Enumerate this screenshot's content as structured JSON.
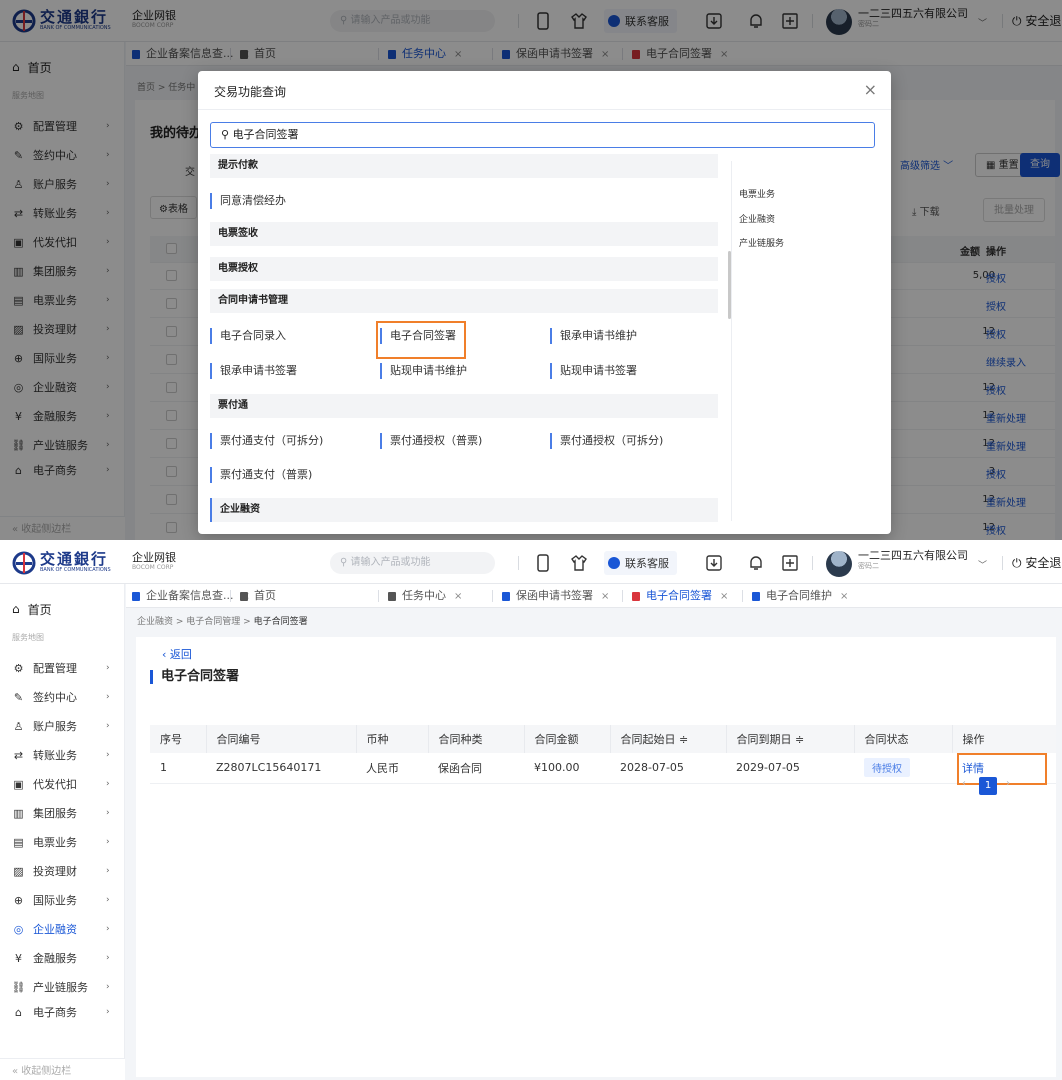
{
  "brand": {
    "name_cn": "交通銀行",
    "name_en": "BANK OF COMMUNICATIONS",
    "portal": "企业网银",
    "portal_sub": "BOCOM CORP"
  },
  "topbar": {
    "search_placeholder": "请输入产品或功能",
    "contact_label": "联系客服",
    "company_name": "一二三四五六有限公司",
    "company_sub": "密码二",
    "logout_label": "安全退"
  },
  "sidebar": {
    "home": "首页",
    "map_label": "服务地图",
    "items": [
      {
        "label": "配置管理",
        "icon": "gear-icon"
      },
      {
        "label": "签约中心",
        "icon": "pen-icon"
      },
      {
        "label": "账户服务",
        "icon": "user-icon"
      },
      {
        "label": "转账业务",
        "icon": "transfer-icon"
      },
      {
        "label": "代发代扣",
        "icon": "payroll-icon"
      },
      {
        "label": "集团服务",
        "icon": "building-icon"
      },
      {
        "label": "电票业务",
        "icon": "bill-icon"
      },
      {
        "label": "投资理财",
        "icon": "chart-icon"
      },
      {
        "label": "国际业务",
        "icon": "globe-icon"
      },
      {
        "label": "企业融资",
        "icon": "target-icon"
      },
      {
        "label": "金融服务",
        "icon": "yen-icon"
      },
      {
        "label": "产业链服务",
        "icon": "chain-icon"
      },
      {
        "label": "电子商务",
        "icon": "shop-icon"
      }
    ],
    "collapse_label": "收起侧边栏"
  },
  "screenA": {
    "tabs": [
      {
        "label": "企业备案信息查...",
        "color": "#1a57d6"
      },
      {
        "label": "首页",
        "color": "#555555"
      },
      {
        "label": "任务中心",
        "color": "#1a57d6"
      },
      {
        "label": "保函申请书签署",
        "color": "#1a57d6"
      },
      {
        "label": "电子合同签署",
        "color": "#d9353c"
      }
    ],
    "crumb": "首页 > 任务中",
    "page_title": "我的待办",
    "filter_label": "交",
    "advanced_filter": "高级筛选",
    "reset_btn": "重置",
    "query_btn": "查询",
    "table_setting": "表格",
    "download": "下载",
    "batch": "批量处理",
    "col_amount": "金额",
    "col_action": "操作",
    "rows": [
      {
        "amount": "5,00",
        "action": "授权"
      },
      {
        "amount": "",
        "action": "授权"
      },
      {
        "amount": "12",
        "action": "授权"
      },
      {
        "amount": "",
        "action": "继续录入"
      },
      {
        "amount": "12",
        "action": "授权"
      },
      {
        "amount": "12",
        "action": "重新处理"
      },
      {
        "amount": "12",
        "action": "重新处理"
      },
      {
        "amount": "3",
        "action": "授权"
      },
      {
        "amount": "12",
        "action": "重新处理"
      },
      {
        "amount": "12",
        "action": "授权"
      }
    ],
    "modal": {
      "title": "交易功能查询",
      "search_value": "电子合同签署",
      "sections": [
        {
          "title": "提示付款",
          "items": []
        },
        {
          "title": "",
          "items": [
            "同意清偿经办"
          ]
        },
        {
          "title": "电票签收",
          "items": []
        },
        {
          "title": "电票授权",
          "items": []
        },
        {
          "title": "合同申请书管理",
          "items": [
            "电子合同录入",
            "电子合同签署",
            "银承申请书维护",
            "银承申请书签署",
            "贴现申请书维护",
            "贴现申请书签署"
          ]
        },
        {
          "title": "票付通",
          "items": [
            "票付通支付（可拆分)",
            "票付通授权（普票)",
            "票付通授权（可拆分)",
            "票付通支付（普票)"
          ]
        },
        {
          "title": "企业融资",
          "items": []
        }
      ],
      "categories": [
        "电票业务",
        "企业融资",
        "产业链服务"
      ]
    }
  },
  "screenB": {
    "tabs": [
      {
        "label": "企业备案信息查...",
        "color": "#1a57d6"
      },
      {
        "label": "首页",
        "color": "#555555"
      },
      {
        "label": "任务中心",
        "color": "#555555"
      },
      {
        "label": "保函申请书签署",
        "color": "#1a57d6"
      },
      {
        "label": "电子合同签署",
        "color": "#d9353c"
      },
      {
        "label": "电子合同维护",
        "color": "#1a57d6"
      }
    ],
    "crumb": [
      "企业融资",
      "电子合同管理",
      "电子合同签署"
    ],
    "back_label": "返回",
    "title": "电子合同签署",
    "columns": [
      "序号",
      "合同编号",
      "币种",
      "合同种类",
      "合同金额",
      "合同起始日 ≑",
      "合同到期日 ≑",
      "合同状态",
      "操作"
    ],
    "row": {
      "index": "1",
      "contract_no": "Z2807LC15640171",
      "currency": "人民币",
      "type": "保函合同",
      "amount": "¥100.00",
      "start": "2028-07-05",
      "end": "2029-07-05",
      "status": "待授权",
      "action": "详情"
    },
    "page": "1"
  }
}
